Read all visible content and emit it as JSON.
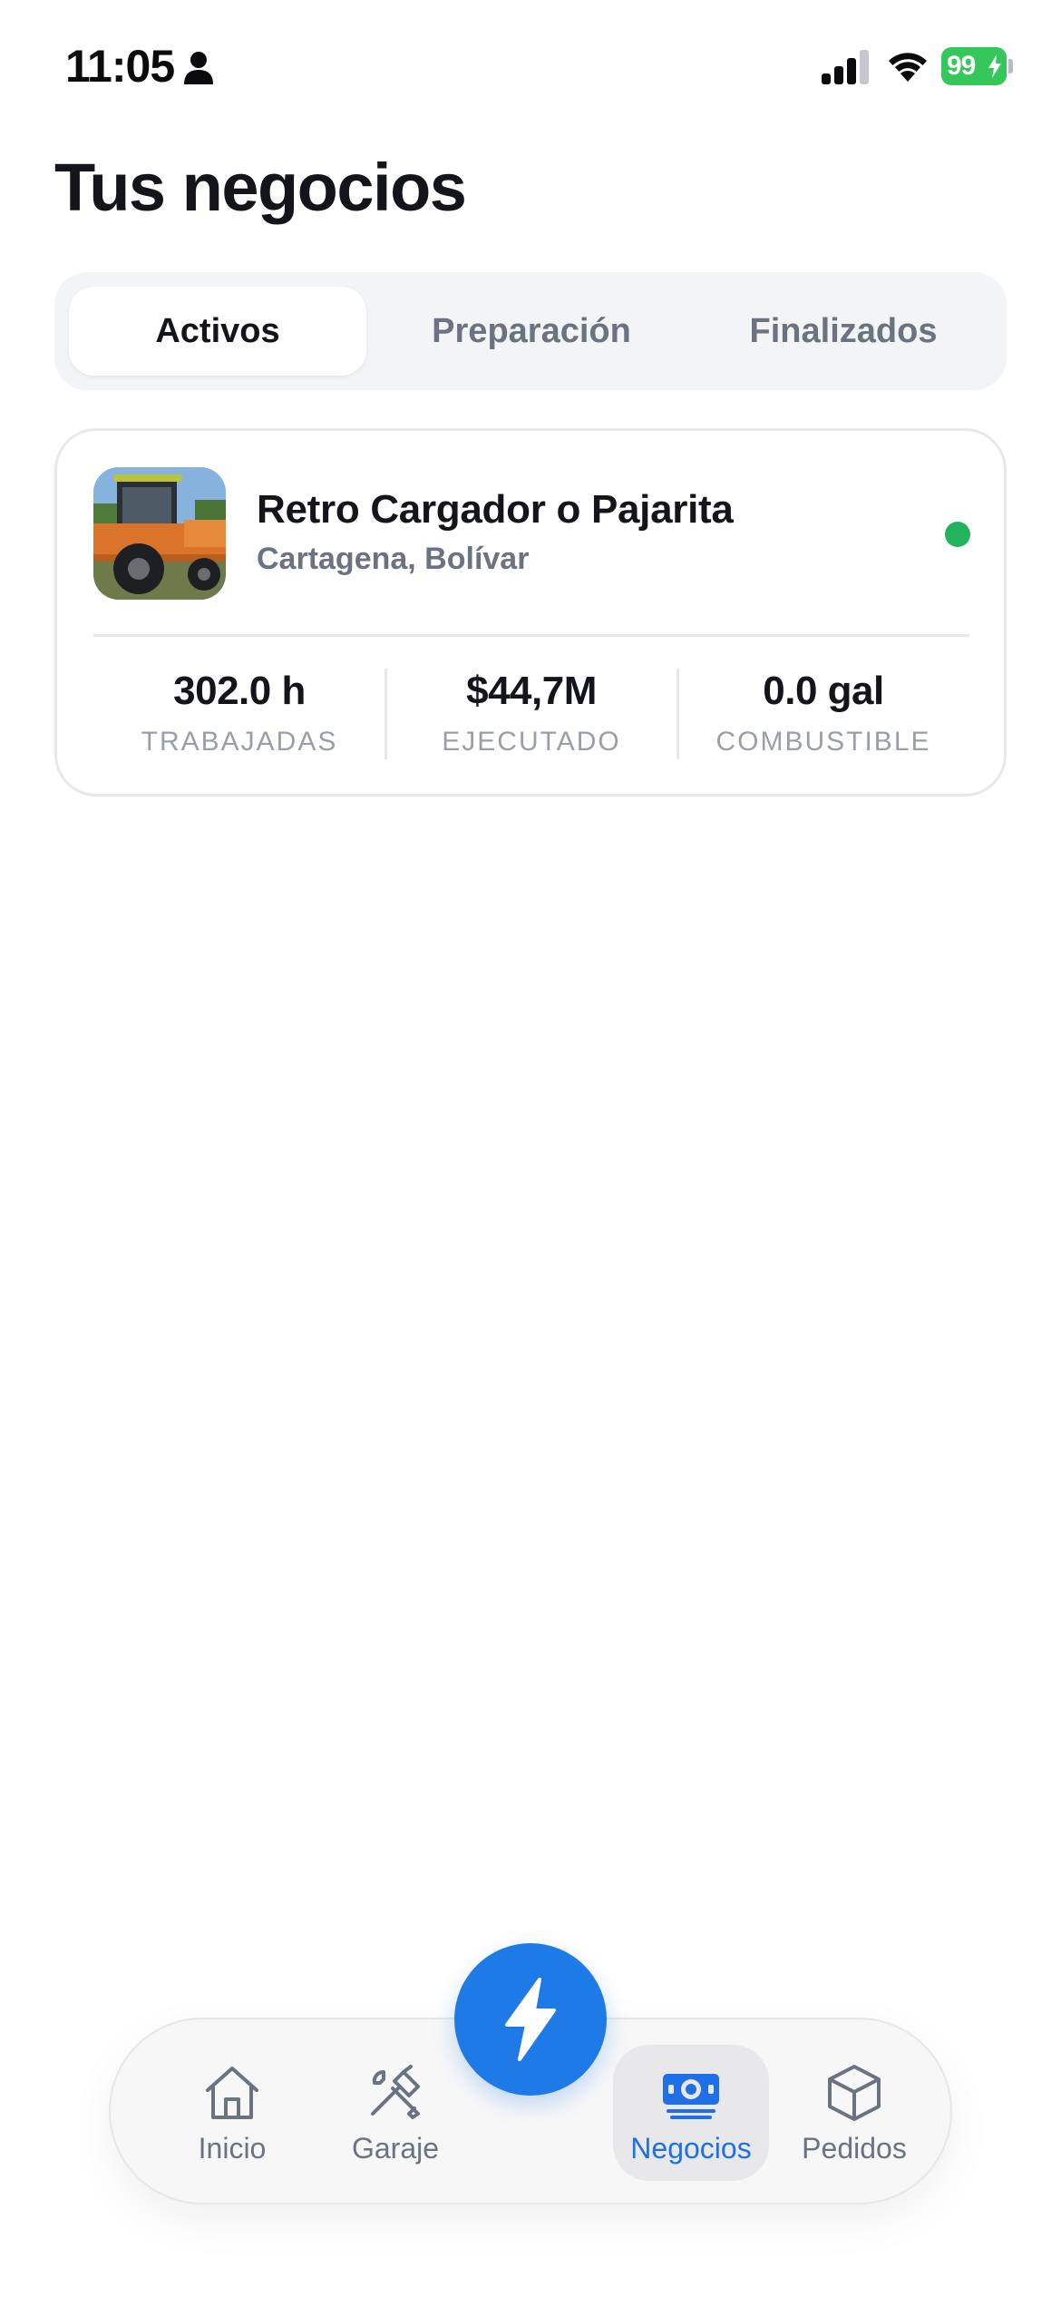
{
  "status_bar": {
    "time": "11:05",
    "battery": "99"
  },
  "page": {
    "title": "Tus negocios"
  },
  "tabs": [
    {
      "label": "Activos",
      "active": true
    },
    {
      "label": "Preparación",
      "active": false
    },
    {
      "label": "Finalizados",
      "active": false
    }
  ],
  "business": {
    "name": "Retro Cargador o Pajarita",
    "location": "Cartagena, Bolívar",
    "status_color": "#22b35e",
    "stats": [
      {
        "value": "302.0 h",
        "label": "TRABAJADAS"
      },
      {
        "value": "$44,7M",
        "label": "EJECUTADO"
      },
      {
        "value": "0.0 gal",
        "label": "COMBUSTIBLE"
      }
    ]
  },
  "nav": {
    "items": [
      {
        "label": "Inicio",
        "icon": "home-icon",
        "active": false
      },
      {
        "label": "Garaje",
        "icon": "tools-icon",
        "active": false
      },
      {
        "label": "Negocios",
        "icon": "money-icon",
        "active": true
      },
      {
        "label": "Pedidos",
        "icon": "box-icon",
        "active": false
      }
    ],
    "fab_icon": "lightning-icon"
  },
  "colors": {
    "accent": "#1e7ae6",
    "active_nav": "#1f6fe5",
    "battery": "#34c759"
  }
}
